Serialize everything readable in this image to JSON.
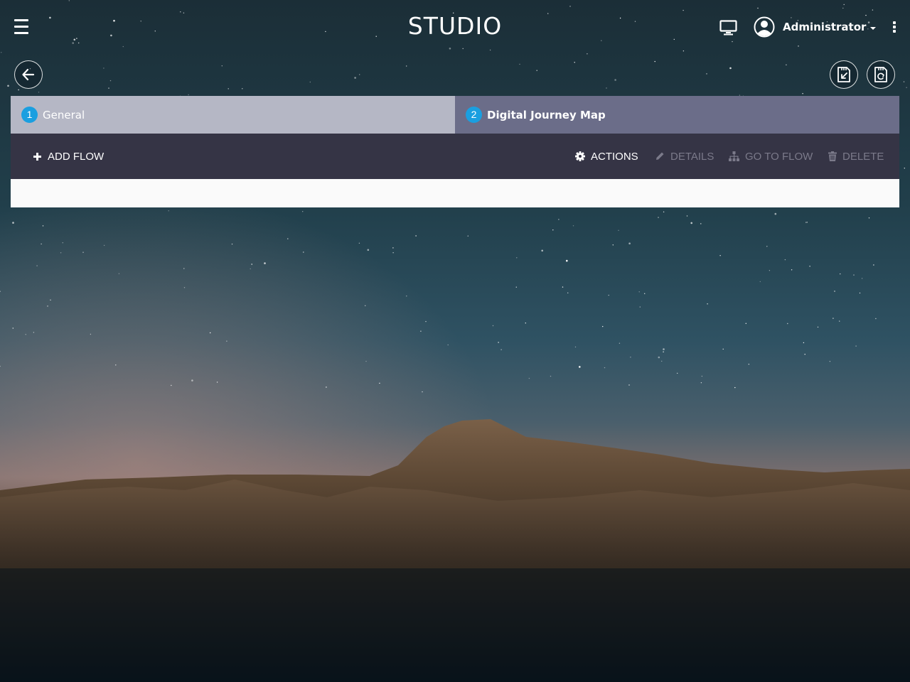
{
  "header": {
    "brand": "STUDIO",
    "user_name": "Administrator",
    "menu_icon": "hamburger-icon",
    "display_icon": "monitor-icon",
    "avatar_icon": "user-avatar-icon",
    "more_icon": "kebab-icon"
  },
  "actions": {
    "back_icon": "arrow-left-icon",
    "import_icon": "sd-card-import-icon",
    "restore_icon": "sd-card-refresh-icon"
  },
  "wizard": {
    "steps": [
      {
        "number": "1",
        "label": "General",
        "active": false
      },
      {
        "number": "2",
        "label": "Digital Journey Map",
        "active": true
      }
    ]
  },
  "toolbar": {
    "add_flow": "ADD FLOW",
    "actions": "ACTIONS",
    "details": "DETAILS",
    "go_to_flow": "GO TO FLOW",
    "delete": "DELETE"
  },
  "colors": {
    "step_badge": "#1a9fe0",
    "step_inactive": "#b5b7c5",
    "step_active": "#6b6d89",
    "toolbar_bg": "#353445",
    "toolbar_disabled": "#7b7a8a"
  }
}
